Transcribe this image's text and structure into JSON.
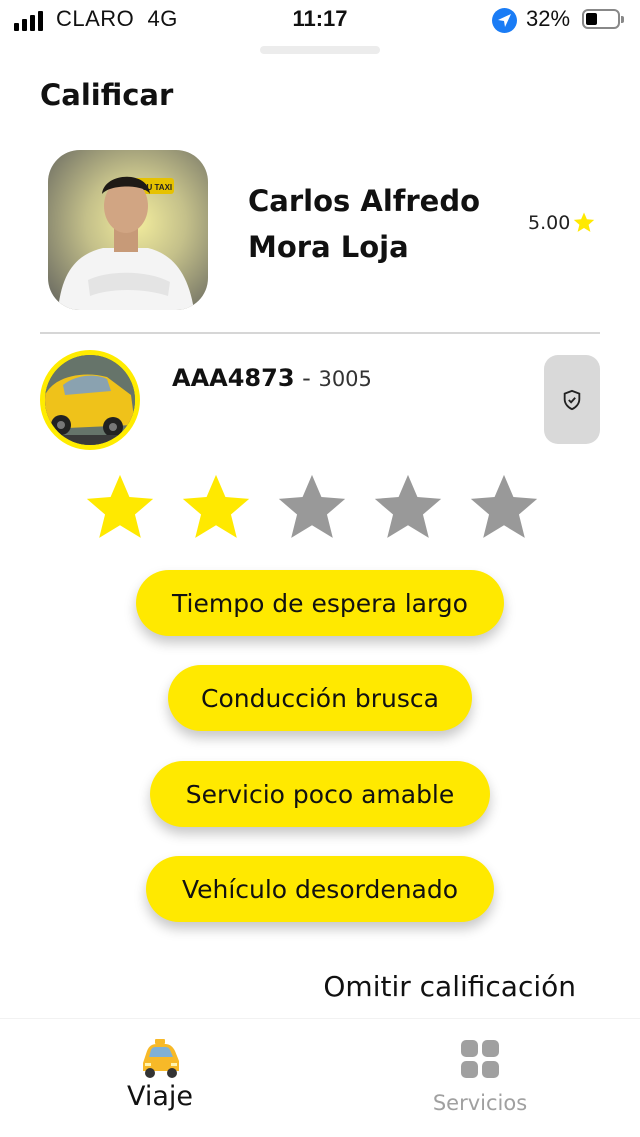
{
  "status_bar": {
    "carrier": "CLARO",
    "network": "4G",
    "time": "11:17",
    "battery": "32%",
    "battery_level": 0.32
  },
  "screen": {
    "title": "Calificar"
  },
  "driver": {
    "name": "Carlos Alfredo Mora Loja",
    "rating": "5.00",
    "photo_badge": "AZU TAXI"
  },
  "vehicle": {
    "plate": "AAA4873",
    "separator": " - ",
    "number": "3005"
  },
  "rating": {
    "selected": 2,
    "max": 5,
    "filled_color": "#ffe900",
    "empty_color": "#999999"
  },
  "feedback_options": [
    {
      "label": "Tiempo de espera largo"
    },
    {
      "label": "Conducción brusca"
    },
    {
      "label": "Servicio poco amable"
    },
    {
      "label": "Vehículo desordenado"
    }
  ],
  "skip_label": "Omitir calificación",
  "tabs": [
    {
      "label": "Viaje",
      "icon": "taxi-icon",
      "active": true
    },
    {
      "label": "Servicios",
      "icon": "grid-icon",
      "active": false
    }
  ],
  "colors": {
    "accent": "#ffe900",
    "inactive_tab": "#a0a0a0"
  }
}
